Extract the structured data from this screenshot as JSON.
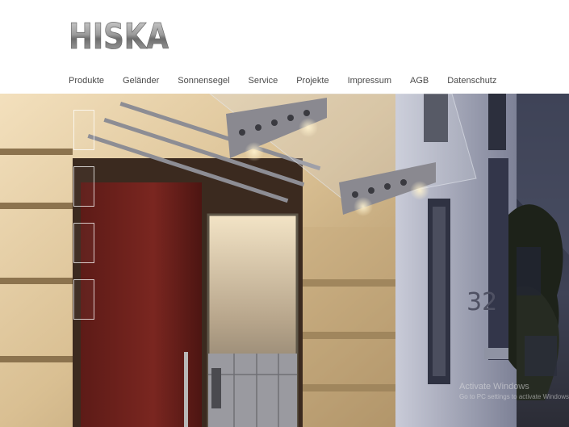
{
  "brand": {
    "logo_text": "HISKA",
    "logo_color": "#8c8c8c"
  },
  "nav": {
    "items": [
      {
        "label": "Produkte",
        "name": "nav-item-produkte"
      },
      {
        "label": "Geländer",
        "name": "nav-item-gelaender"
      },
      {
        "label": "Sonnensegel",
        "name": "nav-item-sonnensegel"
      },
      {
        "label": "Service",
        "name": "nav-item-service"
      },
      {
        "label": "Projekte",
        "name": "nav-item-projekte"
      },
      {
        "label": "Impressum",
        "name": "nav-item-impressum"
      },
      {
        "label": "AGB",
        "name": "nav-item-agb"
      },
      {
        "label": "Datenschutz",
        "name": "nav-item-datenschutz"
      }
    ]
  },
  "hero": {
    "house_number": "32",
    "thumbnail_count": 4
  },
  "watermark": {
    "title": "Activate Windows",
    "subtitle": "Go to PC settings to activate Windows."
  }
}
